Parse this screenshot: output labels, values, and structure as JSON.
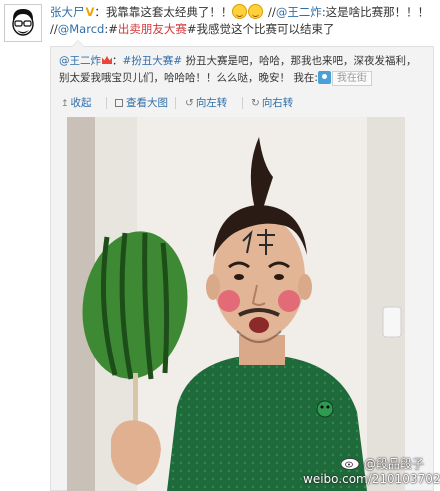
{
  "post": {
    "author": "张大尸",
    "verified_mark": "V",
    "text_1": "：我靠靠这套太经典了！！",
    "text_2": " //",
    "mention_1": "@王二炸",
    "text_3": ":这是啥比赛那！！！",
    "text_4": "//",
    "mention_2": "@Marcd",
    "text_5": ":#",
    "topic": "出卖朋友大赛",
    "text_6": "#我感觉这个比赛可以结束了"
  },
  "repost": {
    "author": "@王二炸",
    "text_1": "：",
    "topic": "#扮丑大赛#",
    "text_2": " 扮丑大赛是吧，哈哈，那我也来吧，深夜发福利，别太爱我哦宝贝儿们，哈哈哈！！么么哒，晚安！ 我在:",
    "location": "我在街"
  },
  "toolbar": {
    "collapse": "收起",
    "view_large": "查看大图",
    "rotate_left": "向左转",
    "rotate_right": "向右转"
  },
  "watermark": {
    "line1": "@段品段子",
    "line2": "weibo.com/2101037029"
  },
  "colors": {
    "link": "#2f6ea8",
    "topic": "#d4373b",
    "repost_bg": "#f3f3f3"
  }
}
